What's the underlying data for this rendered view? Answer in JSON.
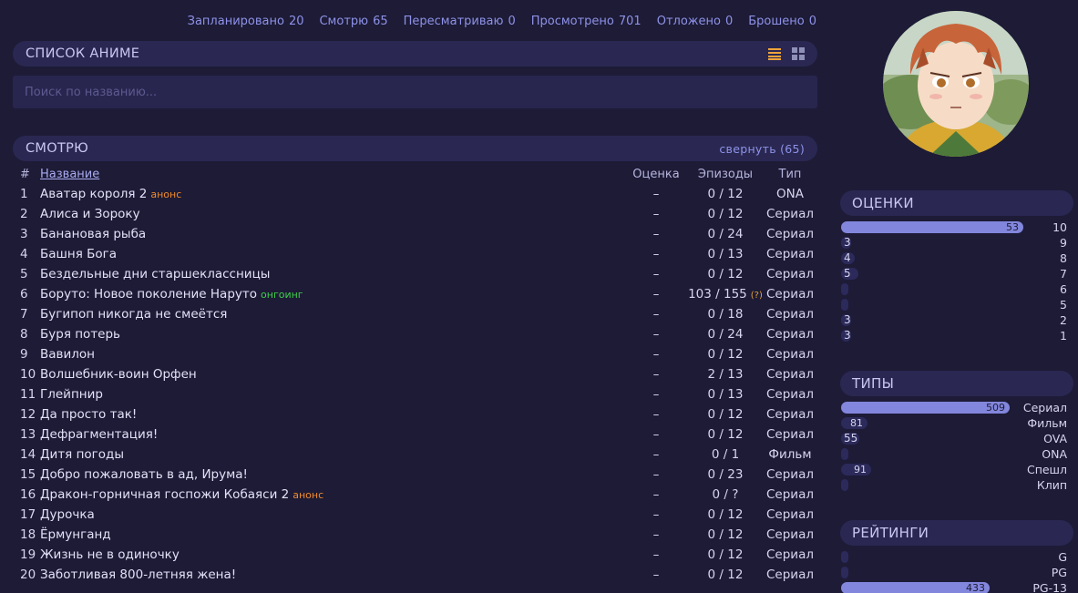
{
  "status": [
    {
      "label": "Запланировано",
      "count": "20"
    },
    {
      "label": "Смотрю",
      "count": "65"
    },
    {
      "label": "Пересматриваю",
      "count": "0"
    },
    {
      "label": "Просмотрено",
      "count": "701"
    },
    {
      "label": "Отложено",
      "count": "0"
    },
    {
      "label": "Брошено",
      "count": "0"
    }
  ],
  "anime_list": {
    "title": "СПИСОК АНИМЕ",
    "search_placeholder": "Поиск по названию..."
  },
  "watching": {
    "title": "СМОТРЮ",
    "collapse": "свернуть (65)",
    "columns": {
      "num": "#",
      "title": "Название",
      "score": "Оценка",
      "eps": "Эпизоды",
      "type": "Тип"
    },
    "rows": [
      {
        "n": "1",
        "title": "Аватар короля 2",
        "tag": "анонс",
        "tag_type": "announce",
        "score": "–",
        "ep": "0 / 12",
        "type": "ONA"
      },
      {
        "n": "2",
        "title": "Алиса и Зороку",
        "score": "–",
        "ep": "0 / 12",
        "type": "Сериал"
      },
      {
        "n": "3",
        "title": "Банановая рыба",
        "score": "–",
        "ep": "0 / 24",
        "type": "Сериал"
      },
      {
        "n": "4",
        "title": "Башня Бога",
        "score": "–",
        "ep": "0 / 13",
        "type": "Сериал"
      },
      {
        "n": "5",
        "title": "Бездельные дни старшеклассницы",
        "score": "–",
        "ep": "0 / 12",
        "type": "Сериал"
      },
      {
        "n": "6",
        "title": "Боруто: Новое поколение Наруто",
        "tag": "онгоинг",
        "tag_type": "ongoing",
        "score": "–",
        "ep": "103 / 155",
        "ep_note": "(?)",
        "type": "Сериал"
      },
      {
        "n": "7",
        "title": "Бугипоп никогда не смеётся",
        "score": "–",
        "ep": "0 / 18",
        "type": "Сериал"
      },
      {
        "n": "8",
        "title": "Буря потерь",
        "score": "–",
        "ep": "0 / 24",
        "type": "Сериал"
      },
      {
        "n": "9",
        "title": "Вавилон",
        "score": "–",
        "ep": "0 / 12",
        "type": "Сериал"
      },
      {
        "n": "10",
        "title": "Волшебник-воин Орфен",
        "score": "–",
        "ep": "2 / 13",
        "type": "Сериал"
      },
      {
        "n": "11",
        "title": "Глейпнир",
        "score": "–",
        "ep": "0 / 13",
        "type": "Сериал"
      },
      {
        "n": "12",
        "title": "Да просто так!",
        "score": "–",
        "ep": "0 / 12",
        "type": "Сериал"
      },
      {
        "n": "13",
        "title": "Дефрагментация!",
        "score": "–",
        "ep": "0 / 12",
        "type": "Сериал"
      },
      {
        "n": "14",
        "title": "Дитя погоды",
        "score": "–",
        "ep": "0 / 1",
        "type": "Фильм"
      },
      {
        "n": "15",
        "title": "Добро пожаловать в ад, Ирума!",
        "score": "–",
        "ep": "0 / 23",
        "type": "Сериал"
      },
      {
        "n": "16",
        "title": "Дракон-горничная госпожи Кобаяси 2",
        "tag": "анонс",
        "tag_type": "announce",
        "score": "–",
        "ep": "0 / ?",
        "type": "Сериал"
      },
      {
        "n": "17",
        "title": "Дурочка",
        "score": "–",
        "ep": "0 / 12",
        "type": "Сериал"
      },
      {
        "n": "18",
        "title": "Ёрмунганд",
        "score": "–",
        "ep": "0 / 12",
        "type": "Сериал"
      },
      {
        "n": "19",
        "title": "Жизнь не в одиночку",
        "score": "–",
        "ep": "0 / 12",
        "type": "Сериал"
      },
      {
        "n": "20",
        "title": "Заботливая 800-летняя жена!",
        "score": "–",
        "ep": "0 / 12",
        "type": "Сериал"
      }
    ]
  },
  "scores": {
    "title": "ОЦЕНКИ",
    "rows": [
      {
        "label": "10",
        "value": 53
      },
      {
        "label": "9",
        "value": 3
      },
      {
        "label": "8",
        "value": 4
      },
      {
        "label": "7",
        "value": 5
      },
      {
        "label": "6",
        "value": 0
      },
      {
        "label": "5",
        "value": 0
      },
      {
        "label": "2",
        "value": 3
      },
      {
        "label": "1",
        "value": 3
      }
    ],
    "max": 57
  },
  "types": {
    "title": "ТИПЫ",
    "rows": [
      {
        "label": "Сериал",
        "value": 509
      },
      {
        "label": "Фильм",
        "value": 81
      },
      {
        "label": "OVA",
        "value": 55
      },
      {
        "label": "ONA",
        "value": 0
      },
      {
        "label": "Спешл",
        "value": 91
      },
      {
        "label": "Клип",
        "value": 0
      }
    ],
    "max": 550
  },
  "ratings": {
    "title": "РЕЙТИНГИ",
    "rows": [
      {
        "label": "G",
        "value": 0
      },
      {
        "label": "PG",
        "value": 0
      },
      {
        "label": "PG-13",
        "value": 433
      }
    ],
    "max": 548
  },
  "colors": {
    "background": "#1d1b36",
    "panel": "#2a2852",
    "accent": "#8e92e8",
    "bar": "#8286dc",
    "announce": "#f08a2b",
    "ongoing": "#3fcf4a"
  }
}
